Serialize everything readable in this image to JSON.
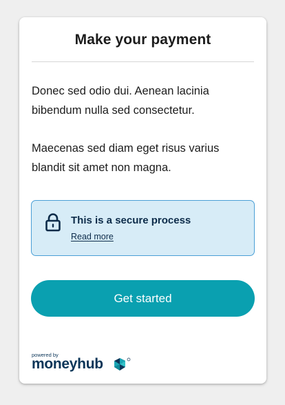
{
  "card": {
    "title": "Make your payment",
    "paragraphs": [
      "Donec sed odio dui. Aenean lacinia bibendum nulla sed consectetur.",
      "Maecenas sed diam eget risus varius blandit sit amet non magna."
    ]
  },
  "secure_notice": {
    "title": "This is a secure process",
    "link_label": "Read more",
    "icon": "lock-icon"
  },
  "cta": {
    "label": "Get started"
  },
  "branding": {
    "powered_by": "powered by",
    "name": "moneyhub",
    "icon": "moneyhub-logo-icon"
  },
  "colors": {
    "page_bg": "#efefef",
    "card_bg": "#ffffff",
    "accent": "#0aa0b0",
    "notice_bg": "#d7ecf7",
    "notice_border": "#4a9fd6",
    "text_dark": "#1c1c1c",
    "navy": "#0b3558"
  }
}
